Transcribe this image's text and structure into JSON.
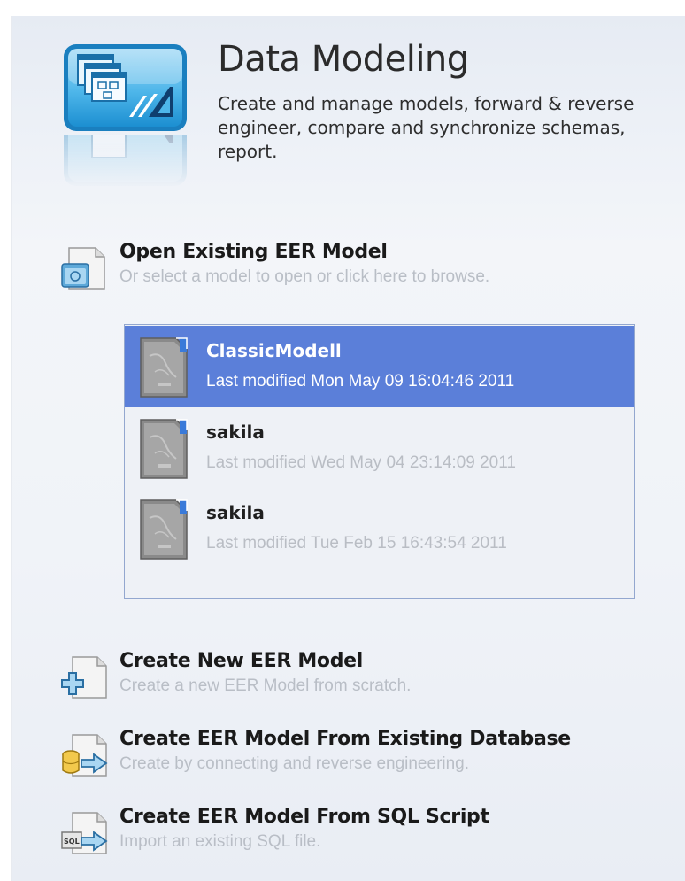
{
  "header": {
    "title": "Data Modeling",
    "description": "Create and manage models, forward & reverse engineer, compare and synchronize schemas, report."
  },
  "open_model": {
    "title": "Open Existing EER Model",
    "subtitle": "Or select a model to open or click here to browse.",
    "icon": "open-folder-document-icon"
  },
  "models": [
    {
      "name": "ClassicModell",
      "modified": "Last modified Mon May 09 16:04:46 2011",
      "selected": true
    },
    {
      "name": "sakila",
      "modified": "Last modified Wed May 04 23:14:09 2011",
      "selected": false
    },
    {
      "name": "sakila",
      "modified": "Last modified Tue Feb 15 16:43:54 2011",
      "selected": false
    }
  ],
  "actions": [
    {
      "title": "Create New EER Model",
      "subtitle": "Create a new EER Model from scratch.",
      "icon": "new-model-plus-icon"
    },
    {
      "title": "Create EER Model From Existing Database",
      "subtitle": "Create by connecting and reverse engineering.",
      "icon": "database-arrow-icon"
    },
    {
      "title": "Create EER Model From SQL Script",
      "subtitle": "Import an existing SQL file.",
      "icon": "sql-script-arrow-icon"
    }
  ],
  "colors": {
    "selection": "#5b7fd9",
    "list_border": "#93a7cf",
    "subtitle_text": "#b9bec6",
    "icon_blue": "#1a86c7"
  }
}
